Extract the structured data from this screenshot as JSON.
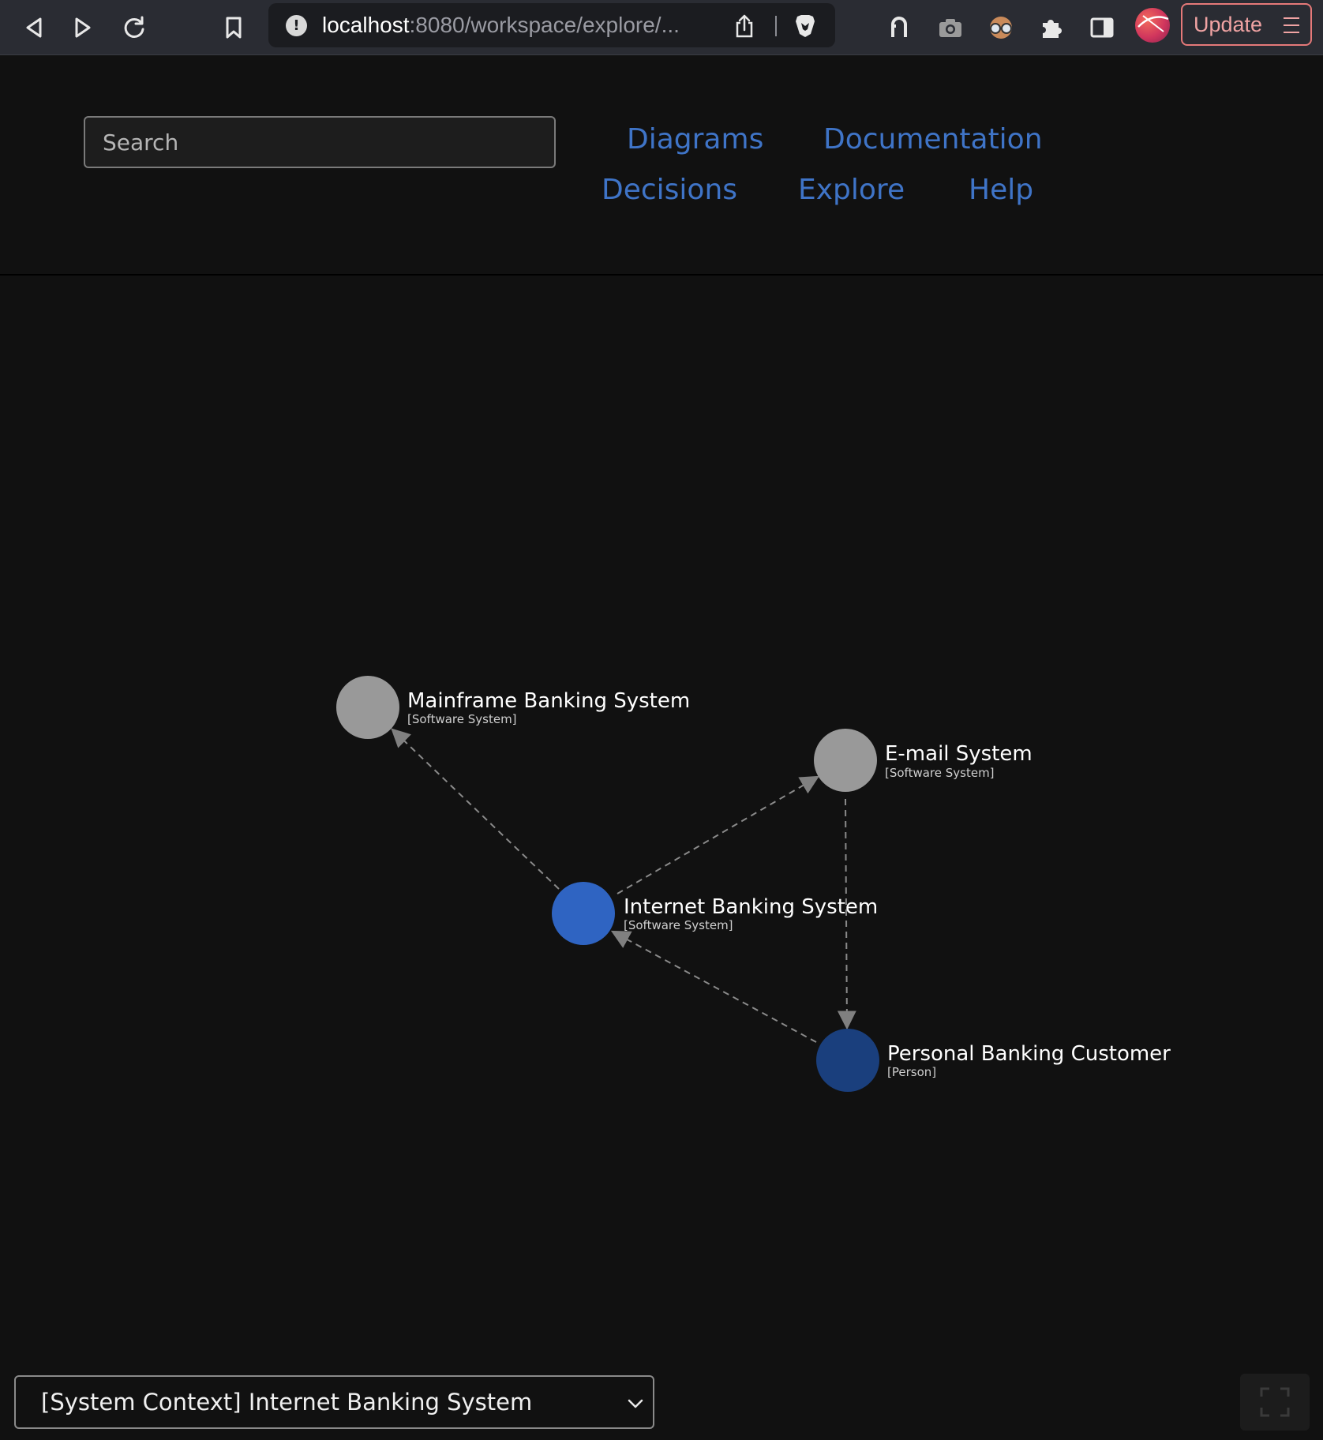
{
  "browser": {
    "url_host": "localhost",
    "url_path": ":8080/workspace/explore/...",
    "update_label": "Update",
    "toolbar_icons": [
      "back-icon",
      "forward-icon",
      "reload-icon",
      "bookmark-icon",
      "site-info-icon",
      "share-icon",
      "brave-shield-icon",
      "extension-arch-icon",
      "camera-icon",
      "glasses-icon",
      "puzzle-icon",
      "sidebar-icon",
      "profile-avatar",
      "menu-icon"
    ]
  },
  "header": {
    "search_placeholder": "Search",
    "nav": {
      "diagrams": "Diagrams",
      "documentation": "Documentation",
      "decisions": "Decisions",
      "explore": "Explore",
      "help": "Help"
    },
    "link_color": "#3f74c7"
  },
  "diagram": {
    "nodes": {
      "mainframe": {
        "name": "Mainframe Banking System",
        "type": "[Software System]",
        "color": "#999999"
      },
      "email": {
        "name": "E-mail System",
        "type": "[Software System]",
        "color": "#999999"
      },
      "internet_banking": {
        "name": "Internet Banking System",
        "type": "[Software System]",
        "color": "#2f64c2"
      },
      "customer": {
        "name": "Personal Banking Customer",
        "type": "[Person]",
        "color": "#1a3f7d"
      }
    },
    "edges": [
      {
        "from": "internet_banking",
        "to": "mainframe"
      },
      {
        "from": "internet_banking",
        "to": "email"
      },
      {
        "from": "email",
        "to": "customer"
      },
      {
        "from": "customer",
        "to": "internet_banking"
      }
    ]
  },
  "footer": {
    "view_select_value": "[System Context] Internet Banking System"
  }
}
